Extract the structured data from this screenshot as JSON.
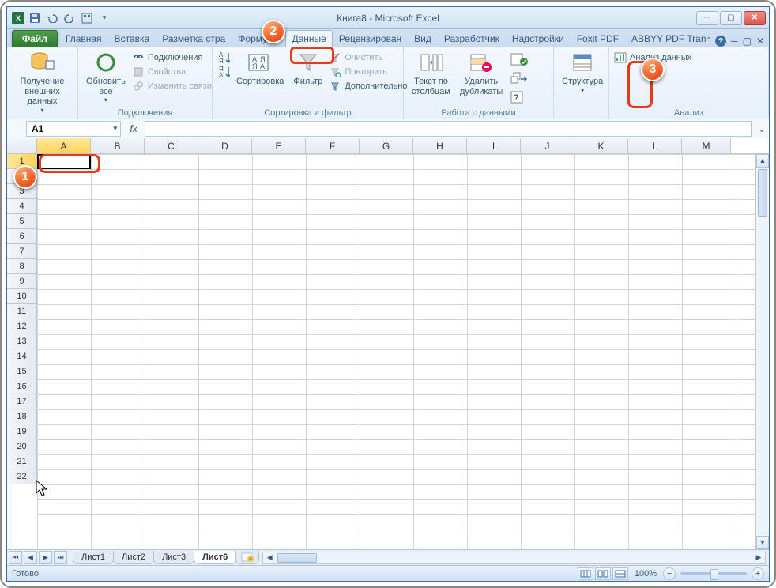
{
  "title": "Книга8  -  Microsoft Excel",
  "qat": {
    "app": "X"
  },
  "tabs": {
    "file": "Файл",
    "items": [
      "Главная",
      "Вставка",
      "Разметка стра",
      "Формулы",
      "Данные",
      "Рецензирован",
      "Вид",
      "Разработчик",
      "Надстройки",
      "Foxit PDF",
      "ABBYY PDF Tran"
    ],
    "active_index": 4
  },
  "ribbon": {
    "g1": {
      "btn": "Получение\nвнешних данных",
      "label": ""
    },
    "g2": {
      "refresh": "Обновить\nвсе",
      "conn": "Подключения",
      "props": "Свойства",
      "links": "Изменить связи",
      "label": "Подключения"
    },
    "g3": {
      "sort": "Сортировка",
      "filter": "Фильтр",
      "clear": "Очистить",
      "reapply": "Повторить",
      "advanced": "Дополнительно",
      "label": "Сортировка и фильтр"
    },
    "g4": {
      "ttc": "Текст по\nстолбцам",
      "dedupe": "Удалить\nдубликаты",
      "label": "Работа с данными"
    },
    "g5": {
      "struct": "Структура"
    },
    "g6": {
      "analysis": "Анализ данных",
      "label": "Анализ"
    }
  },
  "namebox": "A1",
  "columns": [
    "A",
    "B",
    "C",
    "D",
    "E",
    "F",
    "G",
    "H",
    "I",
    "J",
    "K",
    "L",
    "M"
  ],
  "rows": 22,
  "sheets": {
    "items": [
      "Лист1",
      "Лист2",
      "Лист3",
      "Лист6"
    ],
    "active_index": 3
  },
  "status": {
    "ready": "Готово",
    "zoom": "100%"
  },
  "callouts": {
    "c1": "1",
    "c2": "2",
    "c3": "3"
  }
}
